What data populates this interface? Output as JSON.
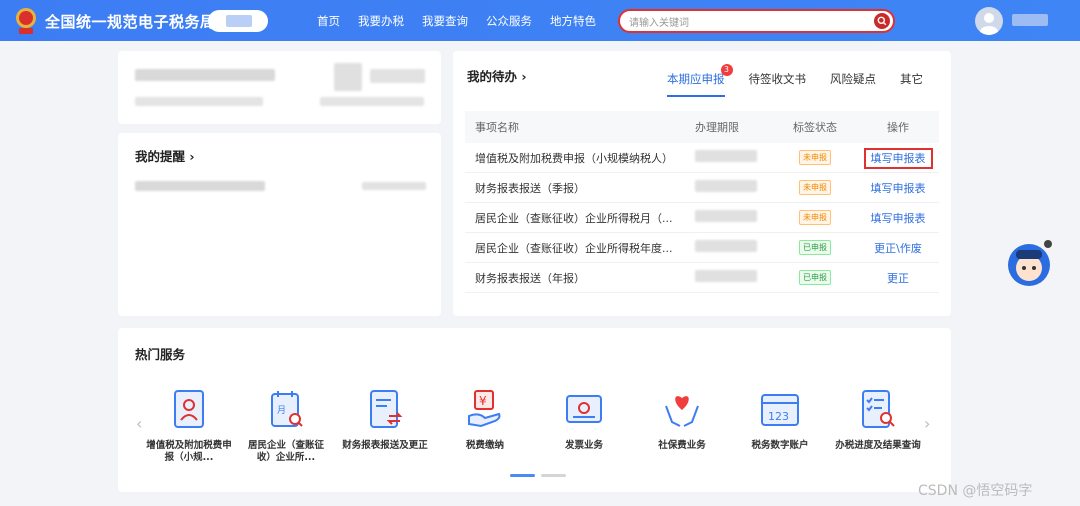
{
  "header": {
    "site_title": "全国统一规范电子税务局",
    "nav": [
      "首页",
      "我要办税",
      "我要查询",
      "公众服务",
      "地方特色"
    ],
    "search_placeholder": "请输入关键词"
  },
  "reminders": {
    "title": "我的提醒 ›"
  },
  "todo": {
    "title": "我的待办 ›",
    "tabs": [
      {
        "label": "本期应申报",
        "badge": "3"
      },
      {
        "label": "待签收文书"
      },
      {
        "label": "风险疑点"
      },
      {
        "label": "其它"
      }
    ],
    "columns": [
      "事项名称",
      "办理期限",
      "标签状态",
      "操作"
    ],
    "rows": [
      {
        "name": "增值税及附加税费申报（小规模纳税人）",
        "status": "未申报",
        "action": "填写申报表"
      },
      {
        "name": "财务报表报送（季报）",
        "status": "未申报",
        "action": "填写申报表"
      },
      {
        "name": "居民企业（查账征收）企业所得税月（...",
        "status": "未申报",
        "action": "填写申报表"
      },
      {
        "name": "居民企业（查账征收）企业所得税年度...",
        "status": "已申报",
        "action": "更正\\作废"
      },
      {
        "name": "财务报表报送（年报）",
        "status": "已申报",
        "action": "更正"
      }
    ]
  },
  "hot_services": {
    "title": "热门服务",
    "items": [
      {
        "label": "增值税及附加税费申报（小规...",
        "icon": "document-person-icon"
      },
      {
        "label": "居民企业（查账征收）企业所...",
        "icon": "calendar-search-icon"
      },
      {
        "label": "财务报表报送及更正",
        "icon": "document-exchange-icon"
      },
      {
        "label": "税费缴纳",
        "icon": "yuan-hand-icon"
      },
      {
        "label": "发票业务",
        "icon": "invoice-icon"
      },
      {
        "label": "社保费业务",
        "icon": "heart-hands-icon"
      },
      {
        "label": "税务数字账户",
        "icon": "card-123-icon"
      },
      {
        "label": "办税进度及结果查询",
        "icon": "checklist-search-icon"
      }
    ]
  },
  "watermark": "CSDN @悟空码字",
  "colors": {
    "primary": "#3d7df4",
    "highlight": "#e03131",
    "link": "#2f6fe0"
  }
}
